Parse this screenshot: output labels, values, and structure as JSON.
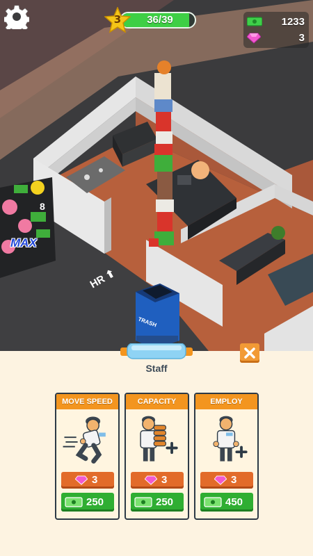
{
  "hud": {
    "level": "3",
    "xp_text": "36/39",
    "xp_progress": 0.923,
    "cash": "1233",
    "gems": "3",
    "settings_icon": "gear-icon"
  },
  "scene": {
    "max_label": "MAX",
    "hr_label": "HR",
    "trash_label": "TRASH"
  },
  "panel": {
    "title": "Staff",
    "close_icon": "close-icon",
    "cards": [
      {
        "title": "MOVE SPEED",
        "gem_cost": "3",
        "cash_cost": "250"
      },
      {
        "title": "CAPACITY",
        "gem_cost": "3",
        "cash_cost": "250"
      },
      {
        "title": "EMPLOY",
        "gem_cost": "3",
        "cash_cost": "450"
      }
    ]
  },
  "colors": {
    "accent_orange": "#f3951f",
    "gem_button": "#e26b2a",
    "cash_button": "#2fae32",
    "xp_green": "#3ecf45",
    "panel_bg": "#fdf3e1"
  }
}
